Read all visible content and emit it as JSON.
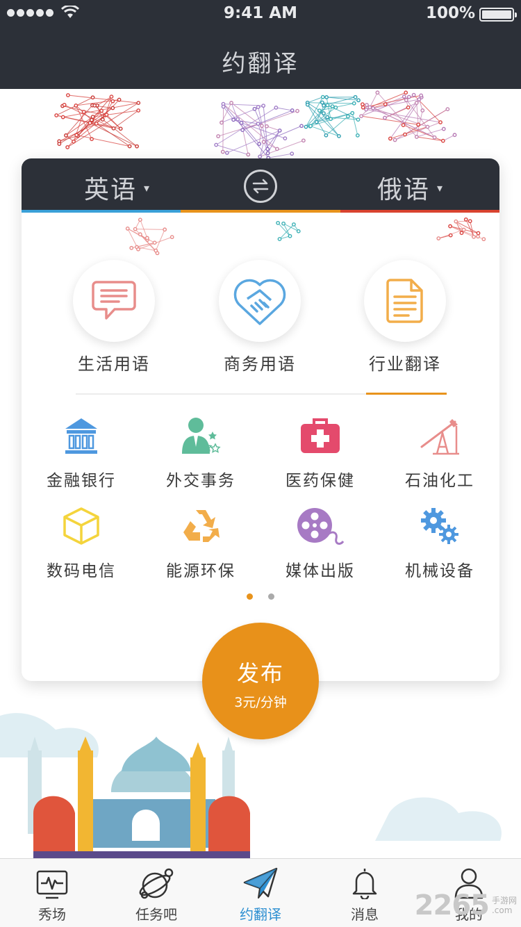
{
  "status": {
    "time": "9:41 AM",
    "battery": "100%"
  },
  "nav": {
    "title": "约翻译"
  },
  "languages": {
    "from": "英语",
    "to": "俄语",
    "caret": "▾"
  },
  "categories": [
    {
      "label": "生活用语",
      "icon": "chat-bubble-icon"
    },
    {
      "label": "商务用语",
      "icon": "handshake-icon"
    },
    {
      "label": "行业翻译",
      "icon": "document-icon"
    }
  ],
  "active_category_index": 2,
  "industries": [
    {
      "label": "金融银行",
      "icon": "bank-icon"
    },
    {
      "label": "外交事务",
      "icon": "diplomat-icon"
    },
    {
      "label": "医药保健",
      "icon": "medical-kit-icon"
    },
    {
      "label": "石油化工",
      "icon": "oil-rig-icon"
    },
    {
      "label": "数码电信",
      "icon": "cube-icon"
    },
    {
      "label": "能源环保",
      "icon": "recycle-icon"
    },
    {
      "label": "媒体出版",
      "icon": "film-reel-icon"
    },
    {
      "label": "机械设备",
      "icon": "gears-icon"
    }
  ],
  "pager": {
    "pages": 2,
    "current": 1
  },
  "publish": {
    "label": "发布",
    "price": "3元/分钟"
  },
  "tabs": [
    {
      "label": "秀场",
      "icon": "pulse-monitor-icon"
    },
    {
      "label": "任务吧",
      "icon": "planet-icon"
    },
    {
      "label": "约翻译",
      "icon": "paper-plane-icon"
    },
    {
      "label": "消息",
      "icon": "bell-icon"
    },
    {
      "label": "我的",
      "icon": "user-icon"
    }
  ],
  "active_tab_index": 2,
  "watermark": {
    "number": "2265",
    "site": "手游网",
    "domain": ".com"
  },
  "colors": {
    "dark": "#2c3038",
    "accent": "#e8931c",
    "tab_active": "#2d8fd1",
    "stripe": [
      "#7fbf5a",
      "#3aa0d8",
      "#e8931c",
      "#d9432f"
    ]
  }
}
